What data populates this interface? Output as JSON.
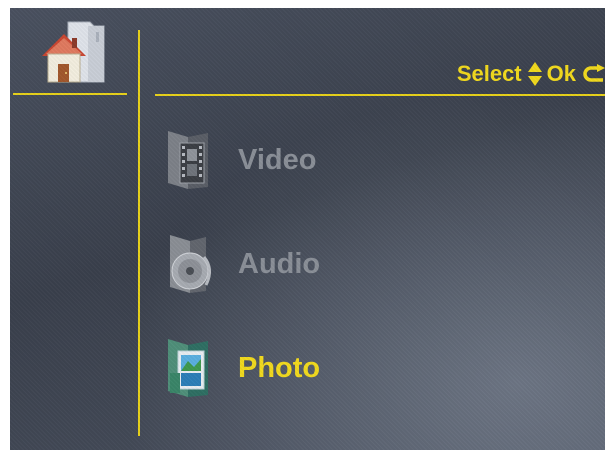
{
  "hint": {
    "select_label": "Select",
    "ok_label": "Ok",
    "select_icon": "up-down-arrows-icon",
    "ok_icon": "return-arrow-icon"
  },
  "home": {
    "icon": "home-folder-icon"
  },
  "menu": {
    "items": [
      {
        "label": "Video",
        "icon": "film-reel-icon",
        "selected": false
      },
      {
        "label": "Audio",
        "icon": "cd-disc-icon",
        "selected": false
      },
      {
        "label": "Photo",
        "icon": "photo-frame-icon",
        "selected": true
      }
    ]
  },
  "colors": {
    "accent": "#f2da1e",
    "inactive_text": "#8a8f98",
    "background": "#404653"
  }
}
